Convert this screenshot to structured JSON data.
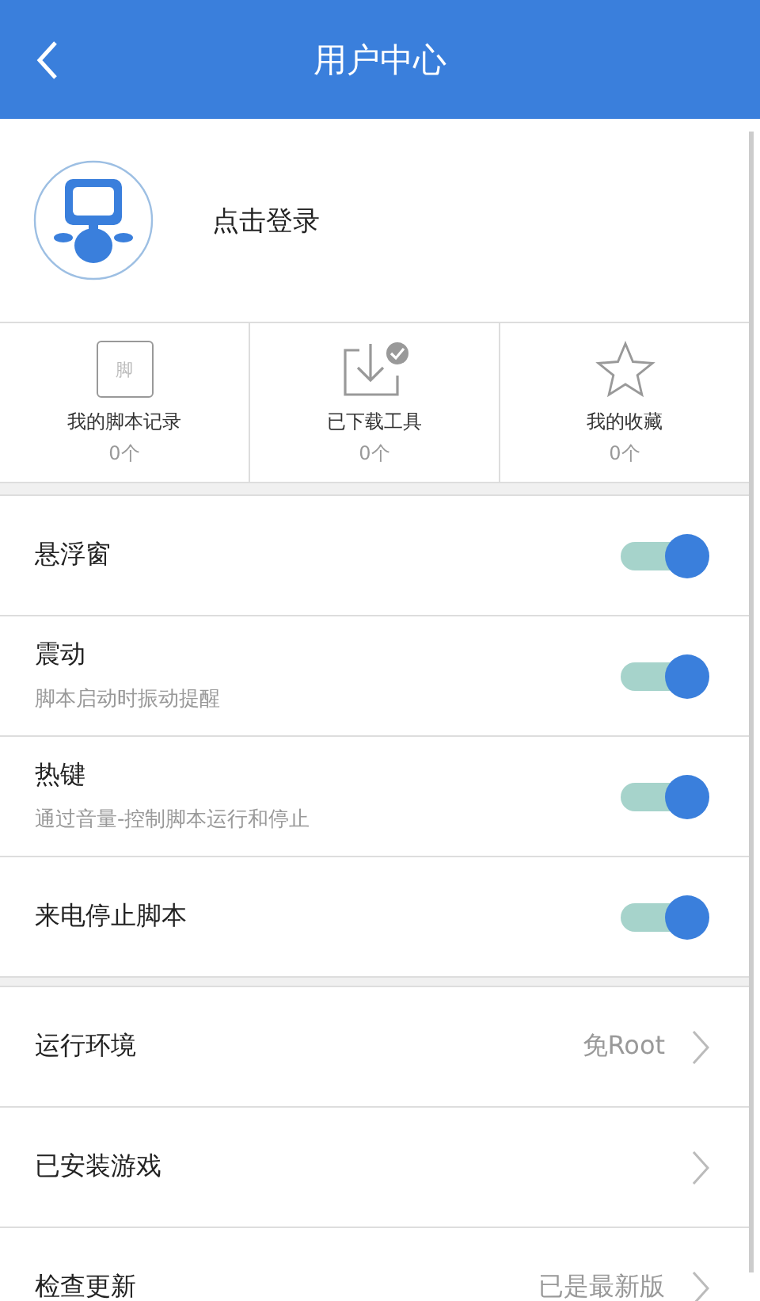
{
  "header": {
    "title": "用户中心"
  },
  "profile": {
    "login": "点击登录"
  },
  "stats": [
    {
      "kind": "folder",
      "icon_glyph": "脚",
      "label": "我的脚本记录",
      "count": "0个"
    },
    {
      "kind": "download",
      "label": "已下载工具",
      "count": "0个"
    },
    {
      "kind": "star",
      "label": "我的收藏",
      "count": "0个"
    }
  ],
  "toggles": [
    {
      "label": "悬浮窗",
      "on": true
    },
    {
      "label": "震动",
      "hint": "脚本启动时振动提醒",
      "on": true
    },
    {
      "label": "热键",
      "hint": "通过音量-控制脚本运行和停止",
      "on": true
    },
    {
      "label": "来电停止脚本",
      "on": true
    }
  ],
  "links": [
    {
      "label": "运行环境",
      "value": "免Root"
    },
    {
      "label": "已安装游戏"
    },
    {
      "label": "检查更新",
      "value": "已是最新版"
    }
  ]
}
